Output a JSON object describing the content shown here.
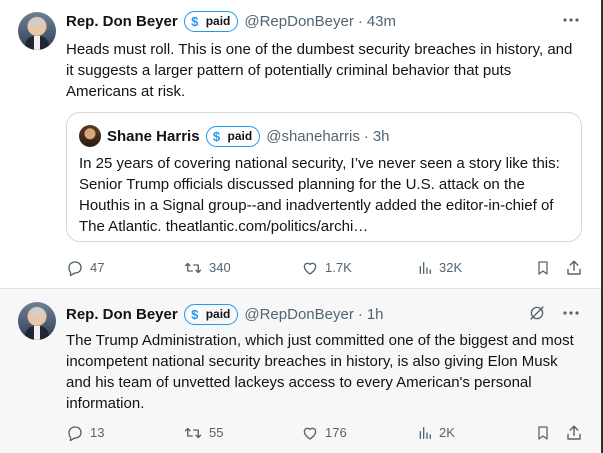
{
  "tweets": [
    {
      "author_name": "Rep. Don Beyer",
      "badge_label": "paid",
      "badge_symbol": "$",
      "handle": "@RepDonBeyer",
      "separator": "·",
      "time": "43m",
      "text": "Heads must roll. This is one of the dumbest security breaches in history, and it suggests a larger pattern of potentially criminal behavior that puts Americans at risk.",
      "quote": {
        "author_name": "Shane Harris",
        "badge_label": "paid",
        "badge_symbol": "$",
        "handle": "@shaneharris",
        "separator": "·",
        "time": "3h",
        "text": "In 25 years of covering national security, I’ve never seen a story like this: Senior Trump officials discussed planning for the U.S. attack on the Houthis in a Signal group--and inadvertently added the editor-in-chief of The Atlantic. theatlantic.com/politics/archi…"
      },
      "stats": {
        "replies": "47",
        "reposts": "340",
        "likes": "1.7K",
        "views": "32K"
      }
    },
    {
      "author_name": "Rep. Don Beyer",
      "badge_label": "paid",
      "badge_symbol": "$",
      "handle": "@RepDonBeyer",
      "separator": "·",
      "time": "1h",
      "text": "The Trump Administration, which just committed one of the biggest and most incompetent national security breaches in history, is also giving Elon Musk and his team of unvetted lackeys access to every American's personal information.",
      "stats": {
        "replies": "13",
        "reposts": "55",
        "likes": "176",
        "views": "2K"
      }
    }
  ],
  "icons": {
    "more": "more-icon",
    "grok": "grok-icon",
    "reply": "reply-icon",
    "repost": "repost-icon",
    "like": "like-icon",
    "views": "views-icon",
    "bookmark": "bookmark-icon",
    "share": "share-icon"
  },
  "colors": {
    "text": "#0f1419",
    "secondary": "#536471",
    "accent": "#1d9bf0",
    "border": "#cfd9de",
    "hover_bg": "#f7f7f8"
  }
}
